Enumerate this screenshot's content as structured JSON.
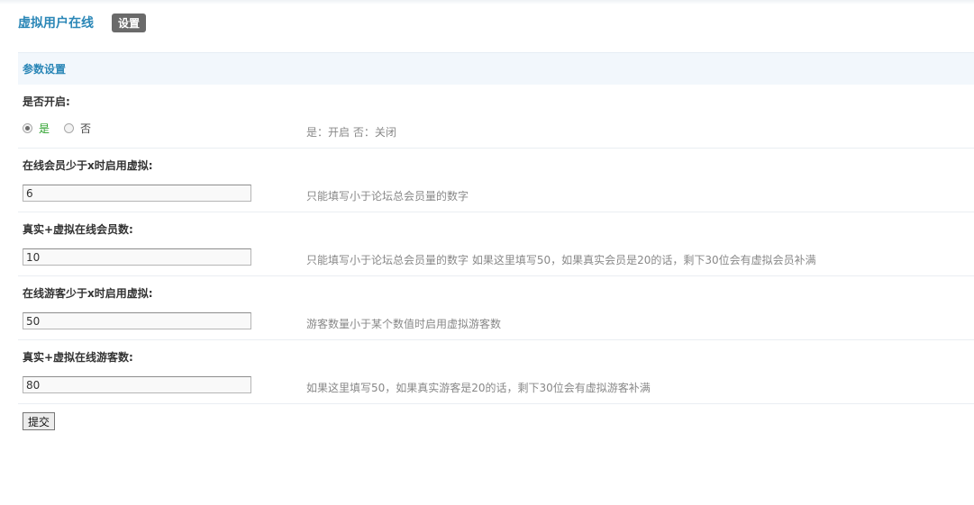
{
  "header": {
    "title": "虚拟用户在线",
    "tab_label": "设置"
  },
  "section": {
    "title": "参数设置"
  },
  "enable": {
    "label": "是否开启:",
    "options": [
      {
        "label": "是",
        "checked": true
      },
      {
        "label": "否",
        "checked": false
      }
    ],
    "hint": "是：开启 否：关闭"
  },
  "fields": [
    {
      "label": "在线会员少于x时启用虚拟:",
      "value": "6",
      "hint": "只能填写小于论坛总会员量的数字"
    },
    {
      "label": "真实+虚拟在线会员数:",
      "value": "10",
      "hint": "只能填写小于论坛总会员量的数字 如果这里填写50，如果真实会员是20的话，剩下30位会有虚拟会员补满"
    },
    {
      "label": "在线游客少于x时启用虚拟:",
      "value": "50",
      "hint": "游客数量小于某个数值时启用虚拟游客数"
    },
    {
      "label": "真实+虚拟在线游客数:",
      "value": "80",
      "hint": "如果这里填写50，如果真实游客是20的话，剩下30位会有虚拟游客补满"
    }
  ],
  "submit_label": "提交",
  "colors": {
    "accent": "#2b87b7",
    "section_bg": "#f2f7fc",
    "yes_color": "#2aa02a"
  }
}
